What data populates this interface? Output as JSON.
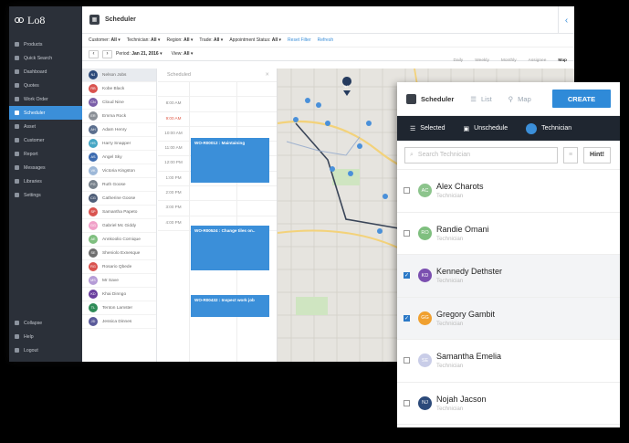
{
  "app": {
    "logo": "Lo8",
    "title": "Scheduler"
  },
  "sidebar": {
    "items": [
      {
        "label": "Products"
      },
      {
        "label": "Quick Search"
      },
      {
        "label": "Dashboard"
      },
      {
        "label": "Quotes"
      },
      {
        "label": "Work Order"
      },
      {
        "label": "Scheduler",
        "active": true
      },
      {
        "label": "Asset"
      },
      {
        "label": "Customer"
      },
      {
        "label": "Report"
      },
      {
        "label": "Messages"
      },
      {
        "label": "Libraries"
      },
      {
        "label": "Settings"
      }
    ],
    "bottom": [
      {
        "label": "Collapse"
      },
      {
        "label": "Help"
      },
      {
        "label": "Logout"
      }
    ]
  },
  "filters": {
    "customer": "Customer:",
    "customer_v": "All",
    "technician": "Technician:",
    "technician_v": "All",
    "region": "Region:",
    "region_v": "All",
    "trade": "Trade:",
    "trade_v": "All",
    "appt": "Appointment Status:",
    "appt_v": "All",
    "reset": "Reset Filter",
    "refresh": "Refresh"
  },
  "period": {
    "label": "Period:",
    "value": "Jan 21, 2016",
    "view": "View:",
    "view_v": "All"
  },
  "views": [
    "Daily",
    "Weekly",
    "Monthly",
    "Assignee",
    "Map"
  ],
  "people": [
    {
      "i": "NJ",
      "n": "Nelson Jobs",
      "c": "#2c4a7a"
    },
    {
      "i": "RB",
      "n": "Kobe Black",
      "c": "#d9534f"
    },
    {
      "i": "CN",
      "n": "Cloud Nine",
      "c": "#7a5ea8"
    },
    {
      "i": "ER",
      "n": "Emma Rock",
      "c": "#8a8f96"
    },
    {
      "i": "AH",
      "n": "Adam Henry",
      "c": "#5b6f8e"
    },
    {
      "i": "HS",
      "n": "Harry Snapper",
      "c": "#46a6c4"
    },
    {
      "i": "AS",
      "n": "Angel Sky",
      "c": "#3c6bb0"
    },
    {
      "i": "VK",
      "n": "Victoria Kingston",
      "c": "#9db8d8"
    },
    {
      "i": "FG",
      "n": "Ruth Goose",
      "c": "#77818b"
    },
    {
      "i": "CG",
      "n": "Catherine Goose",
      "c": "#4f5e78"
    },
    {
      "i": "SP",
      "n": "Samantha Papeto",
      "c": "#d9534f"
    },
    {
      "i": "GG",
      "n": "Gabriel Mc Giddy",
      "c": "#f0a0c8"
    },
    {
      "i": "AE",
      "n": "Annkoolio Cornique",
      "c": "#7fbf7f"
    },
    {
      "i": "SE",
      "n": "Sheniolo Exnesque",
      "c": "#6e6e6e"
    },
    {
      "i": "RG",
      "n": "Rosario Qbede",
      "c": "#d9534f"
    },
    {
      "i": "MS",
      "n": "Mr Save",
      "c": "#b59cd6"
    },
    {
      "i": "KD",
      "n": "Khai Dinngo",
      "c": "#6a3f9e"
    },
    {
      "i": "TL",
      "n": "Tenton Lamster",
      "c": "#2e8b57"
    },
    {
      "i": "JD",
      "n": "Jessica Dinnes",
      "c": "#5a5a9a"
    }
  ],
  "schedule": {
    "header": "Scheduled",
    "times": [
      "",
      "8:00 AM",
      "9:00 AM",
      "10:00 AM",
      "11:00 AM",
      "12:00 PM",
      "1:00 PM",
      "2:00 PM",
      "3:00 PM",
      "4:00 PM"
    ],
    "events": [
      {
        "label": "WO-R00012 : Maintaining"
      },
      {
        "label": "WO-R00524 : Change tiles on.."
      },
      {
        "label": "WO-R00432 : Inspect work job"
      }
    ]
  },
  "map": {
    "pin_label": "NJ"
  },
  "panel": {
    "title": "Scheduler",
    "tab_list": "List",
    "tab_map": "Map",
    "create": "CREATE",
    "tabs": {
      "selected": "Selected",
      "unschedule": "Unschedule",
      "technician": "Technician"
    },
    "search_placeholder": "Search Technician",
    "hint": "Hint!",
    "techs": [
      {
        "i": "AC",
        "n": "Alex Charots",
        "r": "Technician",
        "c": "#8cc48c",
        "checked": false
      },
      {
        "i": "RO",
        "n": "Randie Omani",
        "r": "Technician",
        "c": "#7fbf7f",
        "checked": false
      },
      {
        "i": "KD",
        "n": "Kennedy Dethster",
        "r": "Technician",
        "c": "#7b4fb0",
        "checked": true
      },
      {
        "i": "GG",
        "n": "Gregory Gambit",
        "r": "Technician",
        "c": "#f0a030",
        "checked": true
      },
      {
        "i": "SE",
        "n": "Samantha Emelia",
        "r": "Technician",
        "c": "#c9cde8",
        "checked": false
      },
      {
        "i": "NJ",
        "n": "Nojah Jacson",
        "r": "Technician",
        "c": "#2c4a7a",
        "checked": false
      }
    ]
  }
}
